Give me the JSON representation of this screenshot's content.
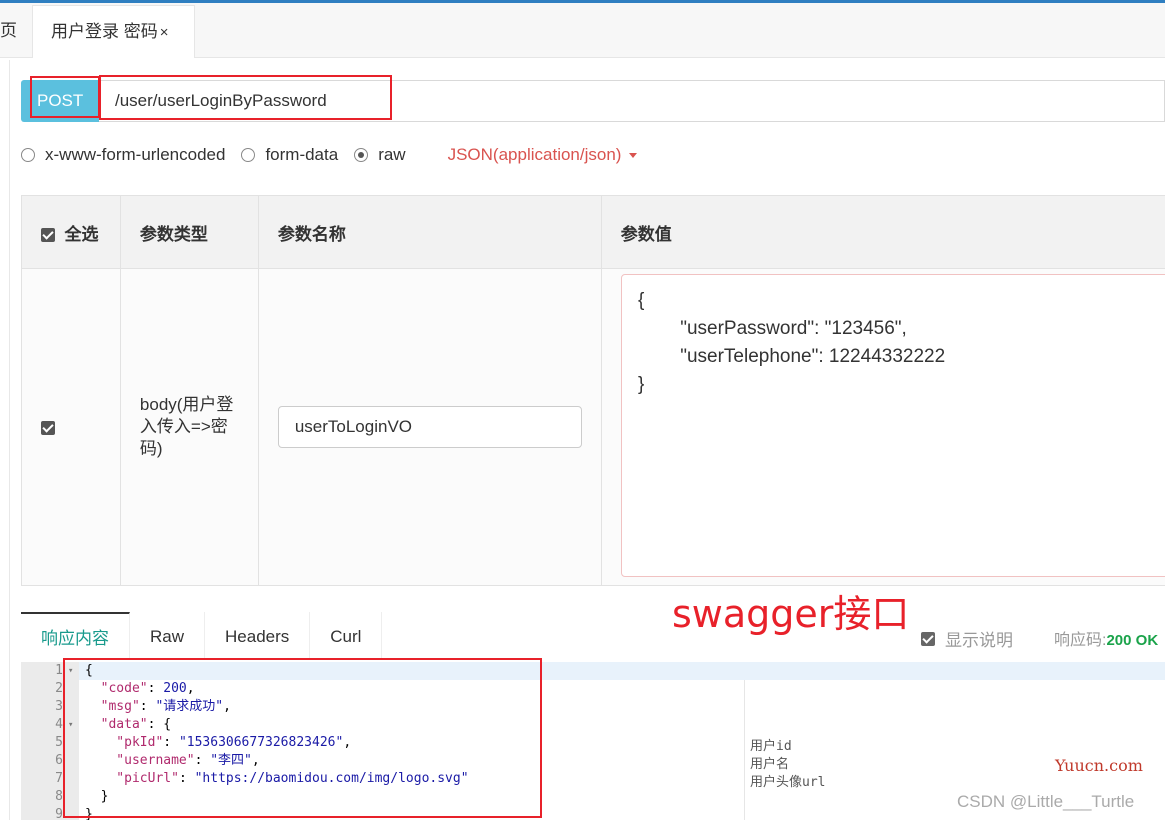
{
  "tabs": {
    "prev_label": "页",
    "active_label": "用户登录 密码",
    "close_icon": "×"
  },
  "request": {
    "method": "POST",
    "url": "/user/userLoginByPassword",
    "body_types": [
      {
        "label": "x-www-form-urlencoded",
        "selected": false
      },
      {
        "label": "form-data",
        "selected": false
      },
      {
        "label": "raw",
        "selected": true
      }
    ],
    "content_type": "JSON(application/json)"
  },
  "params_table": {
    "headers": {
      "select_all": "全选",
      "type": "参数类型",
      "name": "参数名称",
      "value": "参数值"
    },
    "row": {
      "checked": true,
      "type_lines": [
        "body(用户登",
        "入传入=>密",
        "码)"
      ],
      "name": "userToLoginVO",
      "value_lines": [
        "{",
        "        \"userPassword\": \"123456\",",
        "        \"userTelephone\": 12244332222",
        "}"
      ]
    }
  },
  "annotation": "swagger接口",
  "response": {
    "tabs": [
      "响应内容",
      "Raw",
      "Headers",
      "Curl"
    ],
    "show_desc_label": "显示说明",
    "code_label": "响应码:",
    "code_value": "200 OK",
    "lines": [
      {
        "num": "1",
        "fold": true,
        "text": "{"
      },
      {
        "num": "2",
        "fold": false,
        "key": "\"code\"",
        "val": "200",
        "end": ","
      },
      {
        "num": "3",
        "fold": false,
        "key": "\"msg\"",
        "val": "\"请求成功\"",
        "end": ","
      },
      {
        "num": "4",
        "fold": true,
        "key": "\"data\"",
        "val": "{",
        "end": ""
      },
      {
        "num": "5",
        "fold": false,
        "key": "  \"pkId\"",
        "val": "\"1536306677326823426\"",
        "end": ","
      },
      {
        "num": "6",
        "fold": false,
        "key": "  \"username\"",
        "val": "\"李四\"",
        "end": ","
      },
      {
        "num": "7",
        "fold": false,
        "key": "  \"picUrl\"",
        "val": "\"https://baomidou.com/img/logo.svg\"",
        "end": ""
      },
      {
        "num": "8",
        "fold": false,
        "text": "  }"
      },
      {
        "num": "9",
        "fold": false,
        "text": "}"
      }
    ],
    "descriptions": [
      "用户id",
      "用户名",
      "用户头像url"
    ]
  },
  "watermarks": {
    "yuucn": "Yuucn.com",
    "csdn": "CSDN @Little___Turtle"
  },
  "colors": {
    "accent": "#5bc0de",
    "highlight": "#e8212a",
    "active_tab": "#179a8c",
    "ok": "#1aa34a"
  }
}
